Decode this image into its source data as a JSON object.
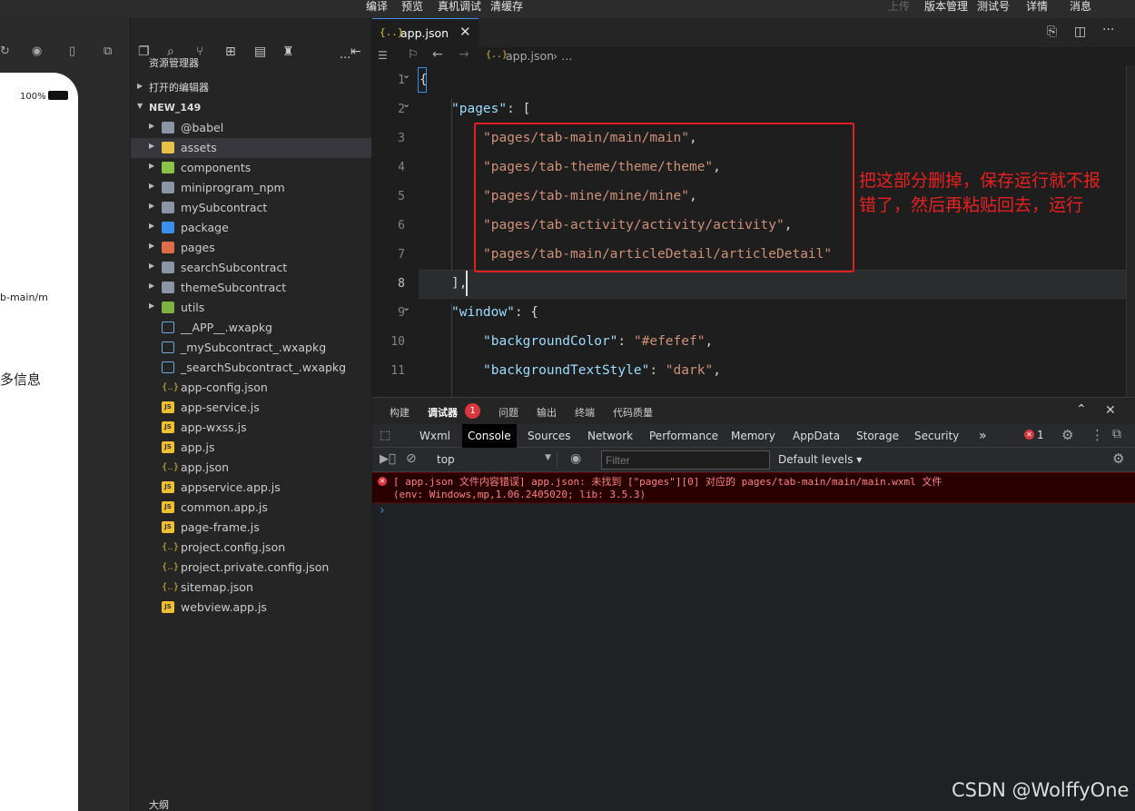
{
  "topmenu": {
    "left": [
      "编译",
      "预览",
      "真机调试",
      "清缓存"
    ],
    "upload": "上传",
    "right": [
      "版本管理",
      "测试号",
      "详情",
      "消息"
    ]
  },
  "phone": {
    "battery": "100%",
    "partial_path": "b-main/m",
    "partial_more": "多信息"
  },
  "explorer": {
    "title": "资源管理器",
    "more": "···",
    "open_editors": "打开的编辑器",
    "project": "NEW_149",
    "items": [
      {
        "label": "@babel",
        "type": "folder"
      },
      {
        "label": "assets",
        "type": "folder"
      },
      {
        "label": "components",
        "type": "folder"
      },
      {
        "label": "miniprogram_npm",
        "type": "folder"
      },
      {
        "label": "mySubcontract",
        "type": "folder"
      },
      {
        "label": "package",
        "type": "folder"
      },
      {
        "label": "pages",
        "type": "folder"
      },
      {
        "label": "searchSubcontract",
        "type": "folder"
      },
      {
        "label": "themeSubcontract",
        "type": "folder"
      },
      {
        "label": "utils",
        "type": "folder"
      },
      {
        "label": "__APP__.wxapkg",
        "type": "file"
      },
      {
        "label": "_mySubcontract_.wxapkg",
        "type": "file"
      },
      {
        "label": "_searchSubcontract_.wxapkg",
        "type": "file"
      },
      {
        "label": "app-config.json",
        "type": "file"
      },
      {
        "label": "app-service.js",
        "type": "file"
      },
      {
        "label": "app-wxss.js",
        "type": "file"
      },
      {
        "label": "app.js",
        "type": "file"
      },
      {
        "label": "app.json",
        "type": "file"
      },
      {
        "label": "appservice.app.js",
        "type": "file"
      },
      {
        "label": "common.app.js",
        "type": "file"
      },
      {
        "label": "page-frame.js",
        "type": "file"
      },
      {
        "label": "project.config.json",
        "type": "file"
      },
      {
        "label": "project.private.config.json",
        "type": "file"
      },
      {
        "label": "sitemap.json",
        "type": "file"
      },
      {
        "label": "webview.app.js",
        "type": "file"
      }
    ],
    "bottom": "大纲"
  },
  "editor": {
    "tab": "app.json",
    "tab_icon": "{..}",
    "breadcrumb_file": "app.json",
    "breadcrumb_rest": "› …",
    "lines": [
      {
        "n": "1",
        "t": "{"
      },
      {
        "n": "2",
        "k": "\"pages\"",
        "t": ": ["
      },
      {
        "n": "3",
        "s": "\"pages/tab-main/main/main\"",
        "t": ","
      },
      {
        "n": "4",
        "s": "\"pages/tab-theme/theme/theme\"",
        "t": ","
      },
      {
        "n": "5",
        "s": "\"pages/tab-mine/mine/mine\"",
        "t": ","
      },
      {
        "n": "6",
        "s": "\"pages/tab-activity/activity/activity\"",
        "t": ","
      },
      {
        "n": "7",
        "s": "\"pages/tab-main/articleDetail/articleDetail\"",
        "t": ""
      },
      {
        "n": "8",
        "t": "],"
      },
      {
        "n": "9",
        "k": "\"window\"",
        "t": ": {"
      },
      {
        "n": "10",
        "k": "\"backgroundColor\"",
        "t": ": ",
        "s": "\"#efefef\"",
        "t2": ","
      },
      {
        "n": "11",
        "k": "\"backgroundTextStyle\"",
        "t": ": ",
        "s": "\"dark\"",
        "t2": ","
      }
    ],
    "annotation": "把这部分删掉，保存运行就不报\n错了，然后再粘贴回去，运行"
  },
  "devtools": {
    "top_tabs": [
      "构建",
      "调试器",
      "问题",
      "输出",
      "终端",
      "代码质量"
    ],
    "badge": "1",
    "tabs": [
      "Wxml",
      "Console",
      "Sources",
      "Network",
      "Performance",
      "Memory",
      "AppData",
      "Storage",
      "Security"
    ],
    "more": "»",
    "err_count": "1",
    "context": "top",
    "filter_placeholder": "Filter",
    "levels": "Default levels ▾",
    "error_line1": "[ app.json 文件内容错误] app.json: 未找到 [\"pages\"][0] 对应的 pages/tab-main/main/main.wxml 文件",
    "error_line2": "(env: Windows,mp,1.06.2405020; lib: 3.5.3)",
    "prompt": "›"
  },
  "watermark": "CSDN @WolffyOne"
}
